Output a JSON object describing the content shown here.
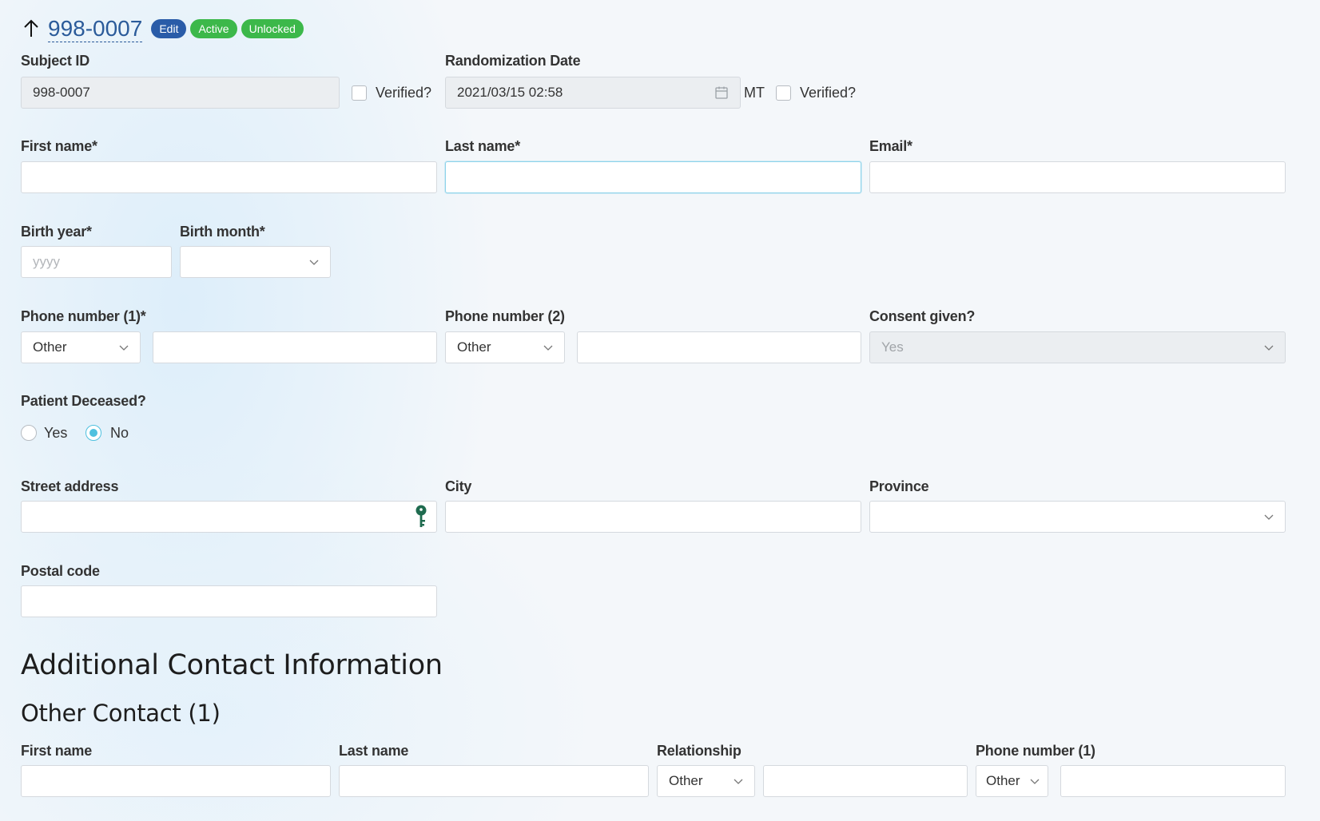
{
  "header": {
    "record_id": "998-0007",
    "badges": {
      "edit": "Edit",
      "active": "Active",
      "unlocked": "Unlocked"
    }
  },
  "subject": {
    "subject_id_label": "Subject ID",
    "subject_id_value": "998-0007",
    "verified_label": "Verified?",
    "randomization_label": "Randomization Date",
    "randomization_value": "2021/03/15 02:58",
    "timezone": "MT",
    "randomization_verified_label": "Verified?"
  },
  "name": {
    "first_label": "First name*",
    "first_value": "",
    "last_label": "Last name*",
    "last_value": "",
    "email_label": "Email*",
    "email_value": ""
  },
  "birth": {
    "year_label": "Birth year*",
    "year_placeholder": "yyyy",
    "month_label": "Birth month*",
    "month_value": ""
  },
  "phones": {
    "phone1_label": "Phone number (1)*",
    "phone1_type": "Other",
    "phone1_value": "",
    "phone2_label": "Phone number (2)",
    "phone2_type": "Other",
    "phone2_value": "",
    "consent_label": "Consent given?",
    "consent_value": "Yes"
  },
  "deceased": {
    "label": "Patient Deceased?",
    "options": [
      "Yes",
      "No"
    ],
    "selected": "No"
  },
  "address": {
    "street_label": "Street address",
    "street_value": "",
    "city_label": "City",
    "city_value": "",
    "province_label": "Province",
    "province_value": "",
    "postal_label": "Postal code",
    "postal_value": ""
  },
  "additional": {
    "section_title": "Additional Contact Information",
    "contact_title": "Other Contact (1)",
    "first_label": "First name",
    "last_label": "Last name",
    "relationship_label": "Relationship",
    "relationship_value": "Other",
    "phone_label": "Phone number (1)",
    "phone_type": "Other"
  },
  "icons": {
    "back": "arrow-up-icon",
    "calendar": "calendar-icon",
    "key": "key-icon",
    "chevron": "chevron-down-icon"
  },
  "colors": {
    "link": "#2b5b9a",
    "edit_badge": "#2a5ca8",
    "status_badge": "#3cb84a",
    "radio_accent": "#4fc1df",
    "key_icon": "#1f6b4f"
  }
}
